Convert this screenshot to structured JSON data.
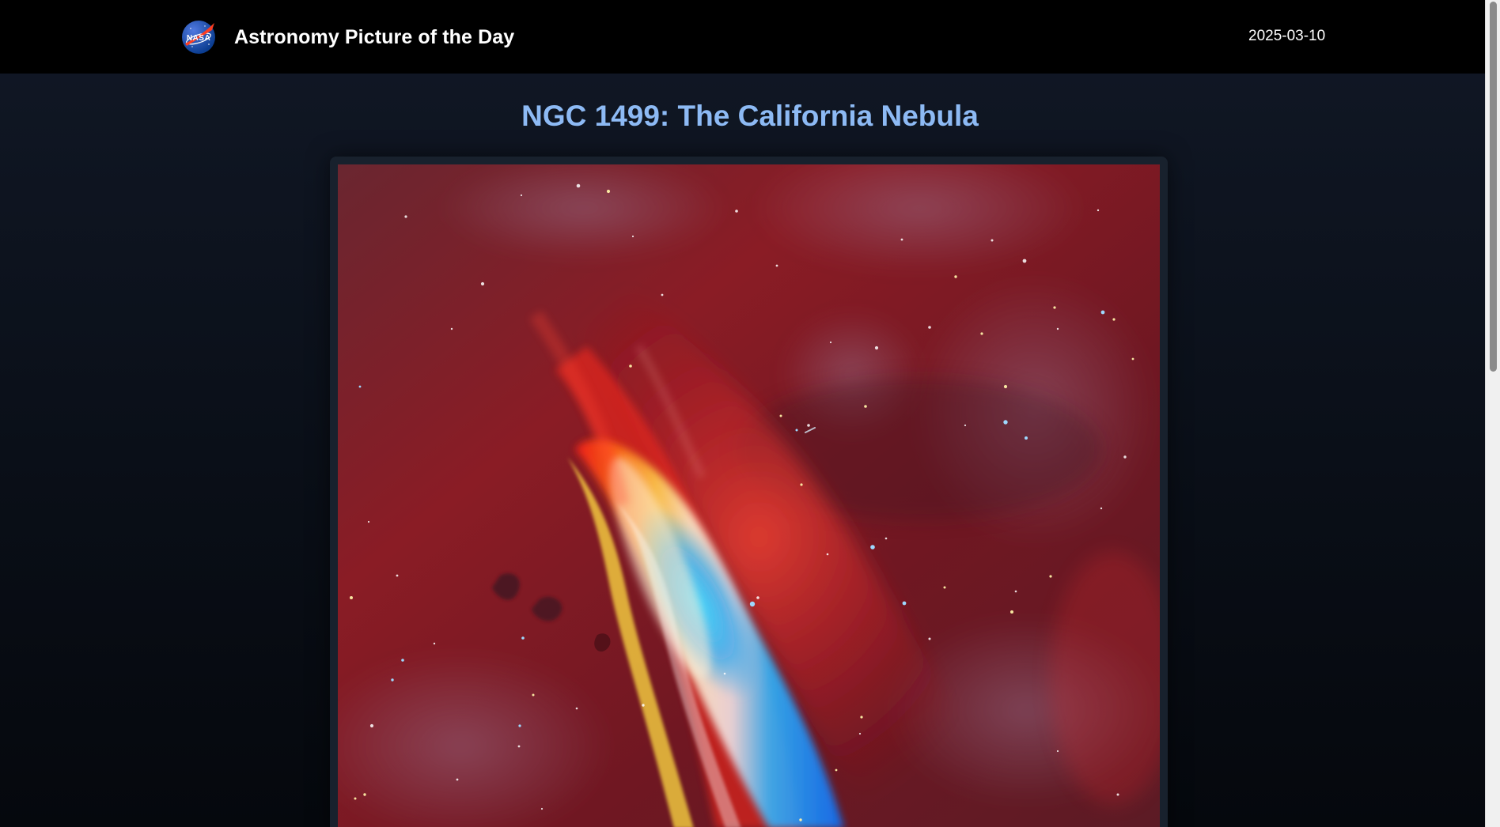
{
  "header": {
    "logo": "nasa-meatball-logo",
    "title": "Astronomy Picture of the Day",
    "date": "2025-03-10"
  },
  "apod": {
    "title": "NGC 1499: The California Nebula",
    "image_subject": "california-nebula-image"
  },
  "scroll": {
    "position": 0
  },
  "colors": {
    "topbar": "#000000",
    "background": "#0b111a",
    "title_accent": "#8dbaf4",
    "card": "#18212d"
  }
}
